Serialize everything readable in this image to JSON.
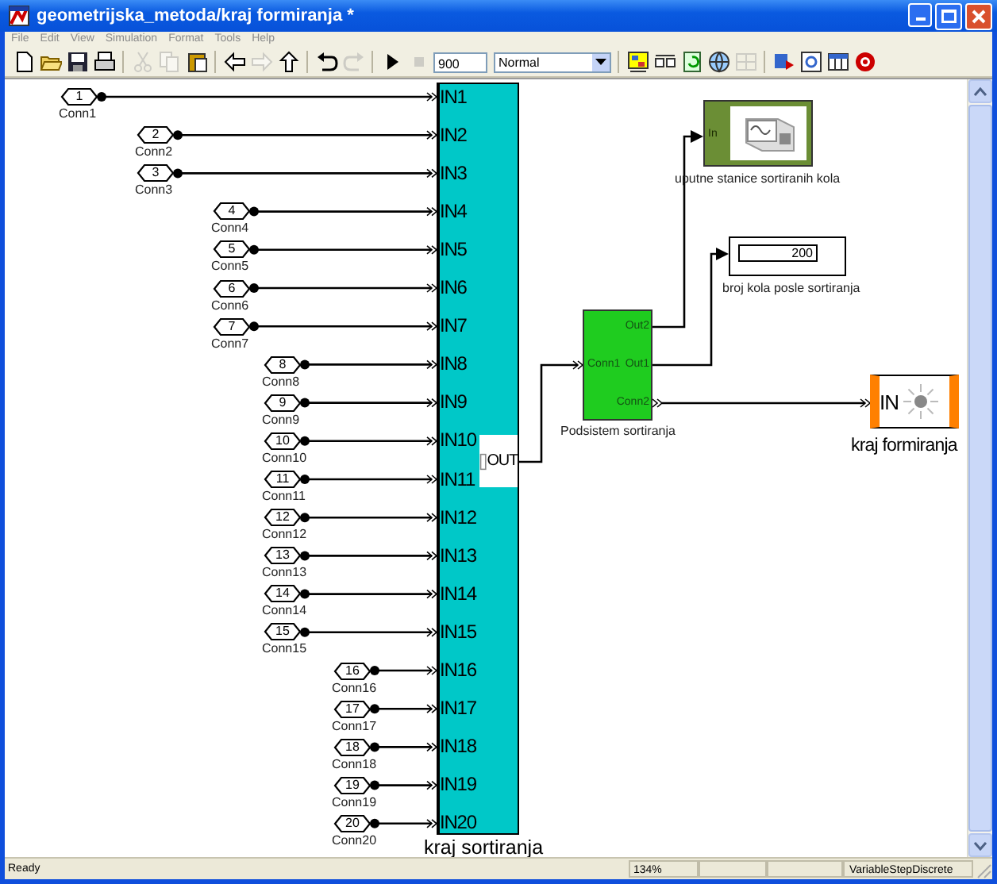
{
  "window": {
    "title": "geometrijska_metoda/kraj formiranja *"
  },
  "menu": [
    "File",
    "Edit",
    "View",
    "Simulation",
    "Format",
    "Tools",
    "Help"
  ],
  "toolbar": {
    "items": [
      {
        "kind": "button",
        "disabled": false
      },
      {
        "kind": "button",
        "disabled": false
      },
      {
        "kind": "button",
        "disabled": false
      },
      {
        "kind": "button",
        "disabled": false
      },
      {
        "kind": "separator"
      },
      {
        "kind": "button",
        "disabled": true
      },
      {
        "kind": "button",
        "disabled": true
      },
      {
        "kind": "button",
        "disabled": false
      },
      {
        "kind": "separator"
      },
      {
        "kind": "button",
        "disabled": false
      },
      {
        "kind": "button",
        "disabled": true
      },
      {
        "kind": "button",
        "disabled": false
      },
      {
        "kind": "separator"
      },
      {
        "kind": "button",
        "disabled": false
      },
      {
        "kind": "button",
        "disabled": true
      },
      {
        "kind": "separator"
      },
      {
        "kind": "button",
        "disabled": false
      },
      {
        "kind": "button",
        "disabled": true
      },
      {
        "kind": "field",
        "value": "900"
      },
      {
        "kind": "dropdown",
        "value": "Normal"
      },
      {
        "kind": "separator"
      },
      {
        "kind": "button",
        "disabled": false
      },
      {
        "kind": "button",
        "disabled": false
      },
      {
        "kind": "button",
        "disabled": false
      },
      {
        "kind": "button",
        "disabled": false
      },
      {
        "kind": "button",
        "disabled": true
      },
      {
        "kind": "separator"
      },
      {
        "kind": "button",
        "disabled": false
      },
      {
        "kind": "button",
        "disabled": false
      },
      {
        "kind": "button",
        "disabled": false
      },
      {
        "kind": "button",
        "disabled": false
      }
    ]
  },
  "diagram": {
    "ports": [
      {
        "number": "1",
        "label": "Conn1"
      },
      {
        "number": "2",
        "label": "Conn2"
      },
      {
        "number": "3",
        "label": "Conn3"
      },
      {
        "number": "4",
        "label": "Conn4"
      },
      {
        "number": "5",
        "label": "Conn5"
      },
      {
        "number": "6",
        "label": "Conn6"
      },
      {
        "number": "7",
        "label": "Conn7"
      },
      {
        "number": "8",
        "label": "Conn8"
      },
      {
        "number": "9",
        "label": "Conn9"
      },
      {
        "number": "10",
        "label": "Conn10"
      },
      {
        "number": "11",
        "label": "Conn11"
      },
      {
        "number": "12",
        "label": "Conn12"
      },
      {
        "number": "13",
        "label": "Conn13"
      },
      {
        "number": "14",
        "label": "Conn14"
      },
      {
        "number": "15",
        "label": "Conn15"
      },
      {
        "number": "16",
        "label": "Conn16"
      },
      {
        "number": "17",
        "label": "Conn17"
      },
      {
        "number": "18",
        "label": "Conn18"
      },
      {
        "number": "19",
        "label": "Conn19"
      },
      {
        "number": "20",
        "label": "Conn20"
      }
    ],
    "main_block": {
      "inputs": [
        "IN1",
        "IN2",
        "IN3",
        "IN4",
        "IN5",
        "IN6",
        "IN7",
        "IN8",
        "IN9",
        "IN10",
        "IN11",
        "IN12",
        "IN13",
        "IN14",
        "IN15",
        "IN16",
        "IN17",
        "IN18",
        "IN19",
        "IN20"
      ],
      "output": "OUT",
      "label": "kraj sortiranja"
    },
    "subsystem": {
      "input": "Conn1",
      "outputs": [
        "Out2",
        "Out1",
        "Conn2"
      ],
      "label": "Podsistem sortiranja"
    },
    "sink_block": {
      "input": "In",
      "label": "uputne stanice sortiranih kola"
    },
    "display_block": {
      "value": "200",
      "label": "broj kola posle sortiranja"
    },
    "end_block": {
      "input": "IN",
      "label": "kraj formiranja"
    }
  },
  "status_bar": {
    "state": "Ready",
    "zoom": "134%",
    "solver": "VariableStepDiscrete"
  }
}
